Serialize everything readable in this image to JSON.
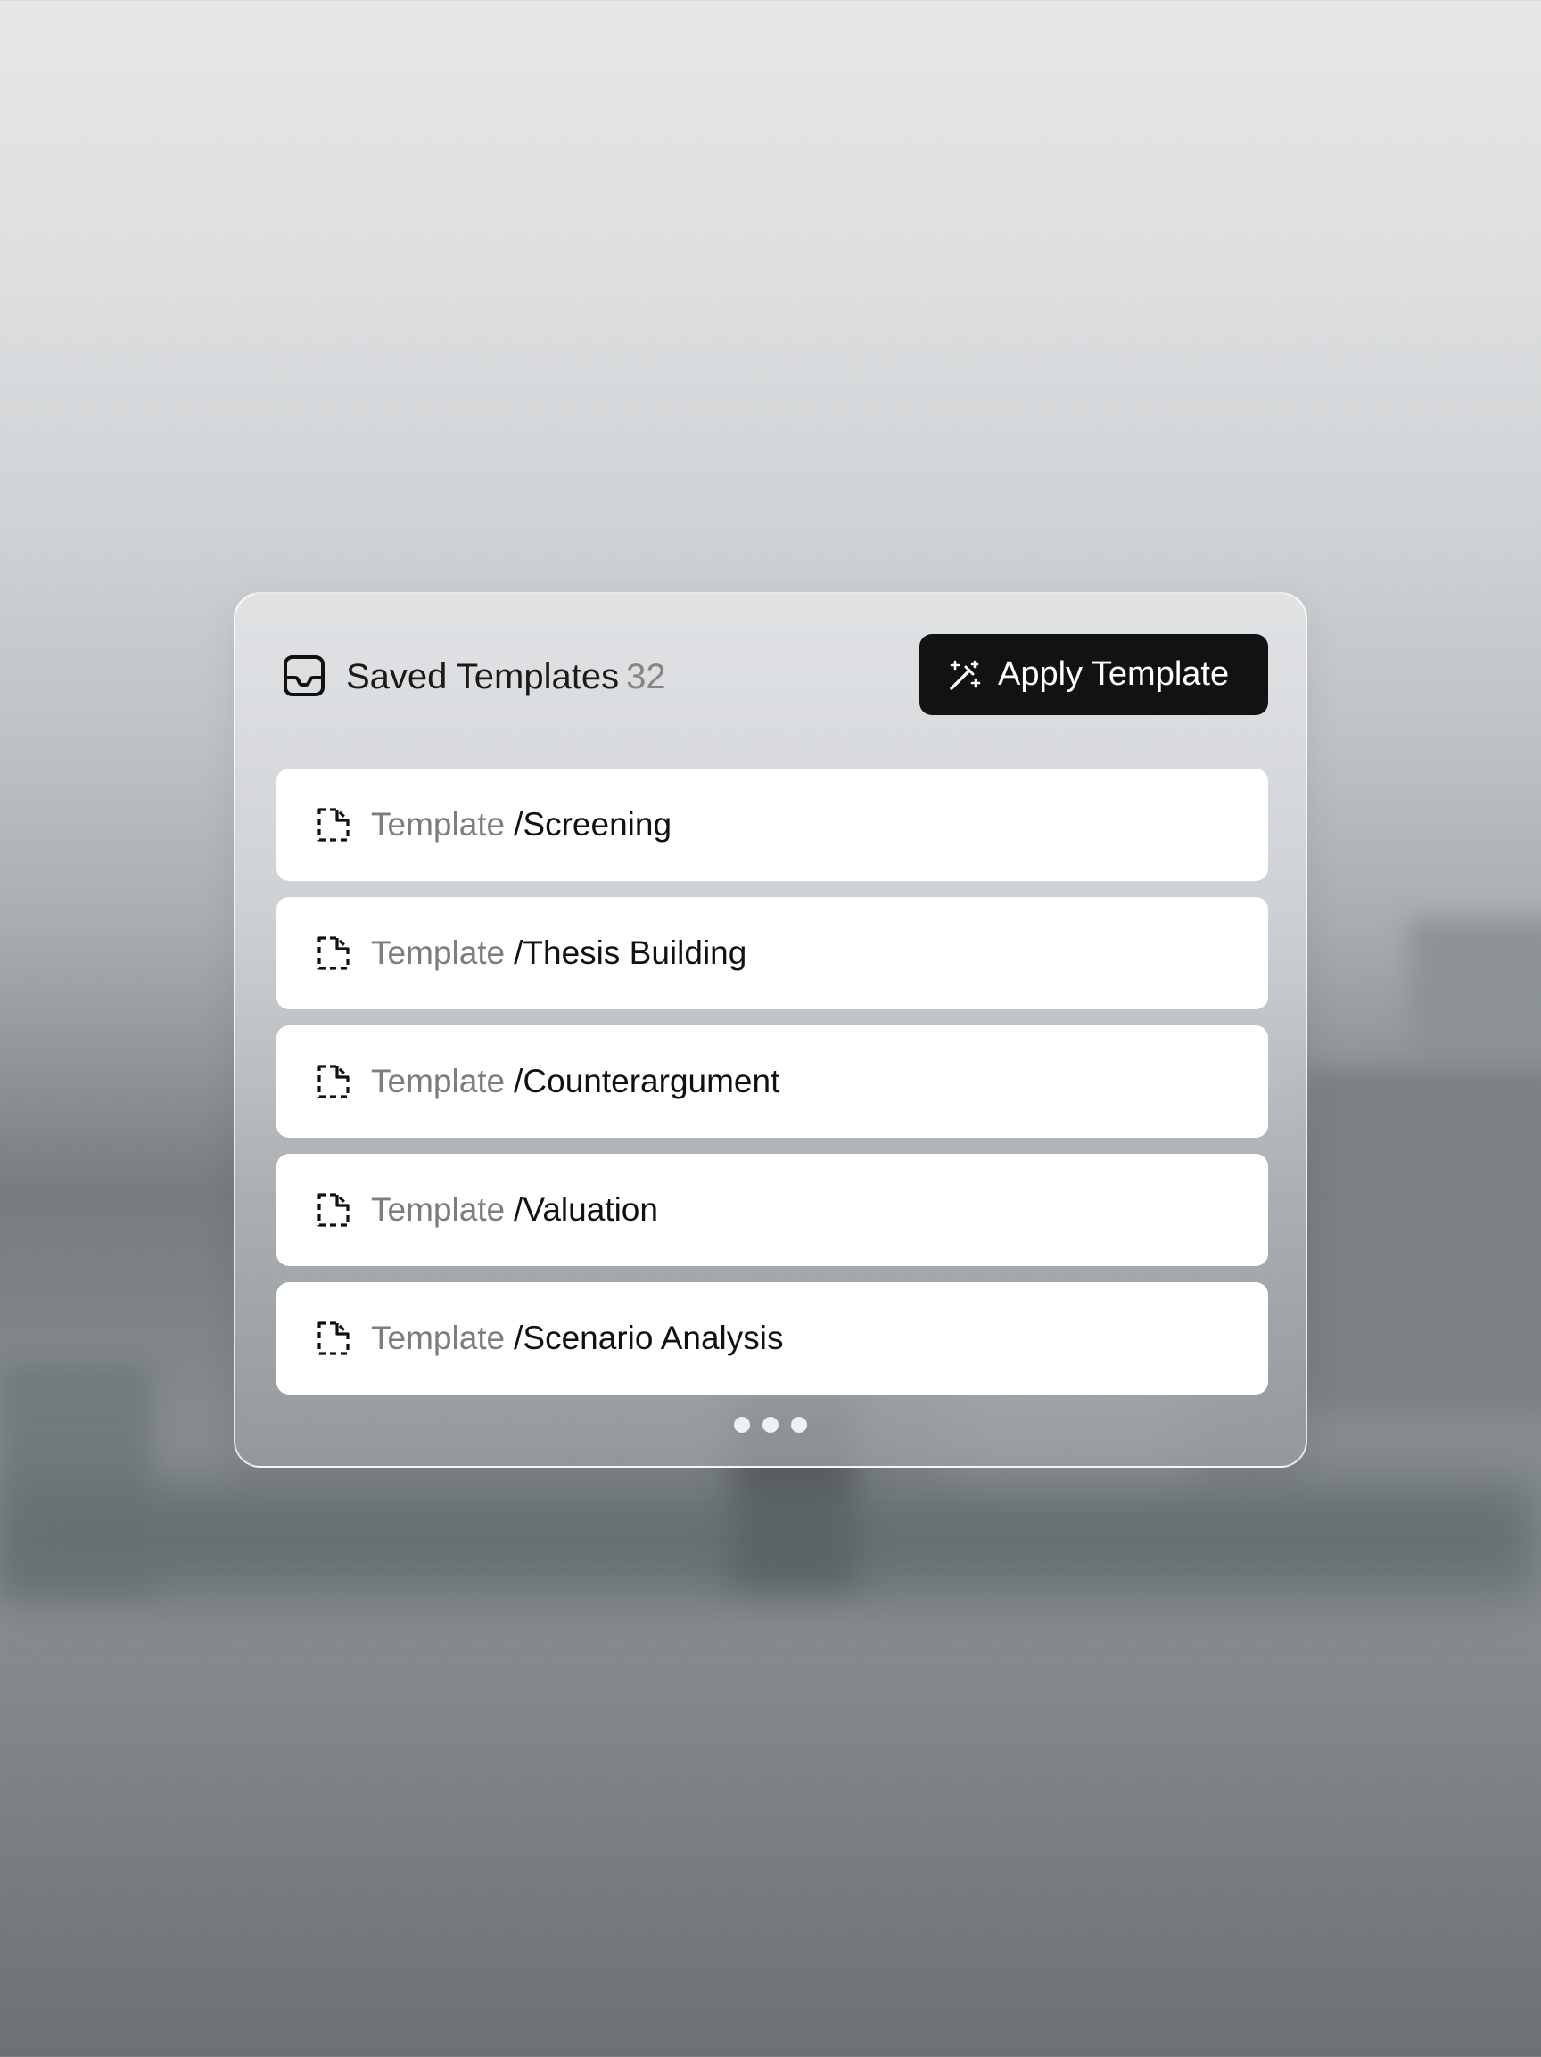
{
  "header": {
    "icon": "inbox-icon",
    "title": "Saved Templates",
    "count": "32"
  },
  "apply_button": {
    "icon": "magic-wand-icon",
    "label": "Apply Template"
  },
  "templates": [
    {
      "icon": "dashed-file-icon",
      "prefix": "Template",
      "separator": "/",
      "name": "Screening"
    },
    {
      "icon": "dashed-file-icon",
      "prefix": "Template",
      "separator": "/",
      "name": "Thesis Building"
    },
    {
      "icon": "dashed-file-icon",
      "prefix": "Template",
      "separator": "/",
      "name": "Counterargument"
    },
    {
      "icon": "dashed-file-icon",
      "prefix": "Template",
      "separator": "/",
      "name": "Valuation"
    },
    {
      "icon": "dashed-file-icon",
      "prefix": "Template",
      "separator": "/",
      "name": "Scenario Analysis"
    }
  ],
  "more_indicator": {
    "icon": "more-dots-icon"
  },
  "colors": {
    "button_bg": "#121212",
    "title_text": "#1a1a1a",
    "muted_text": "#858585",
    "card_bg": "#ffffff"
  }
}
